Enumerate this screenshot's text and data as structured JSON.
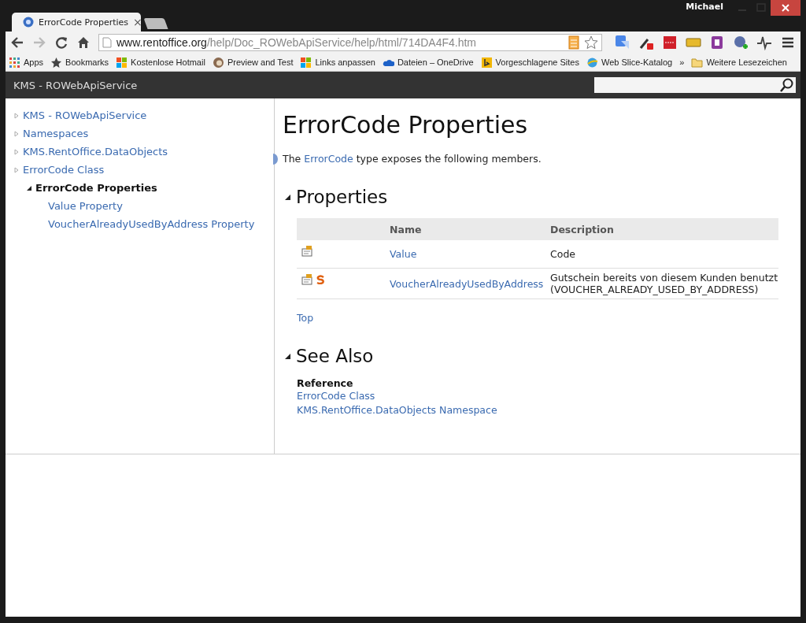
{
  "window": {
    "user": "Michael"
  },
  "tabs": [
    {
      "title": "ErrorCode Properties",
      "close": "×",
      "selected": true
    }
  ],
  "address": {
    "host": "www.rentoffice.org",
    "path": "/help/Doc_ROWebApiService/help/html/714DA4F4.htm"
  },
  "bookmarks": [
    {
      "label": "Apps",
      "kind": "apps"
    },
    {
      "label": "Bookmarks",
      "kind": "star"
    },
    {
      "label": "Kostenlose Hotmail",
      "kind": "tiles"
    },
    {
      "label": "Preview and Test",
      "kind": "round"
    },
    {
      "label": "Links anpassen",
      "kind": "tiles"
    },
    {
      "label": "Dateien – OneDrive",
      "kind": "cloud"
    },
    {
      "label": "Vorgeschlagene Sites",
      "kind": "square"
    },
    {
      "label": "Web Slice-Katalog",
      "kind": "globe"
    },
    {
      "label": "»",
      "kind": "more"
    },
    {
      "label": "Weitere Lesezeichen",
      "kind": "folder"
    }
  ],
  "header": {
    "title": "KMS - ROWebApiService"
  },
  "tree": [
    {
      "label": "KMS - ROWebApiService",
      "expanded": false,
      "selected": false
    },
    {
      "label": "Namespaces",
      "expanded": false,
      "selected": false
    },
    {
      "label": "KMS.RentOffice.DataObjects",
      "expanded": false,
      "selected": false
    },
    {
      "label": "ErrorCode Class",
      "expanded": false,
      "selected": false,
      "children": [
        {
          "label": "ErrorCode Properties",
          "expanded": true,
          "selected": true,
          "children": [
            {
              "label": "Value Property",
              "selected": false
            },
            {
              "label": "VoucherAlreadyUsedByAddress Property",
              "selected": false
            }
          ]
        }
      ]
    }
  ],
  "content": {
    "title": "ErrorCode Properties",
    "intro": [
      "The ",
      "ErrorCode",
      " type exposes the following members."
    ],
    "sections": [
      {
        "heading": "Properties",
        "expanded": true
      }
    ],
    "table": {
      "columns": [
        "Name",
        "Description"
      ],
      "rows": [
        {
          "name": "Value",
          "description": "Code",
          "static": false
        },
        {
          "name": "VoucherAlreadyUsedByAddress",
          "description": "Gutschein bereits von diesem Kunden benutzt (VOUCHER_ALREADY_USED_BY_ADDRESS)",
          "static": true
        }
      ]
    },
    "top_link": "Top",
    "see_also": {
      "heading": "See Also",
      "expanded": true,
      "subheading": "Reference",
      "links": [
        "ErrorCode Class",
        "KMS.RentOffice.DataObjects Namespace"
      ]
    }
  }
}
